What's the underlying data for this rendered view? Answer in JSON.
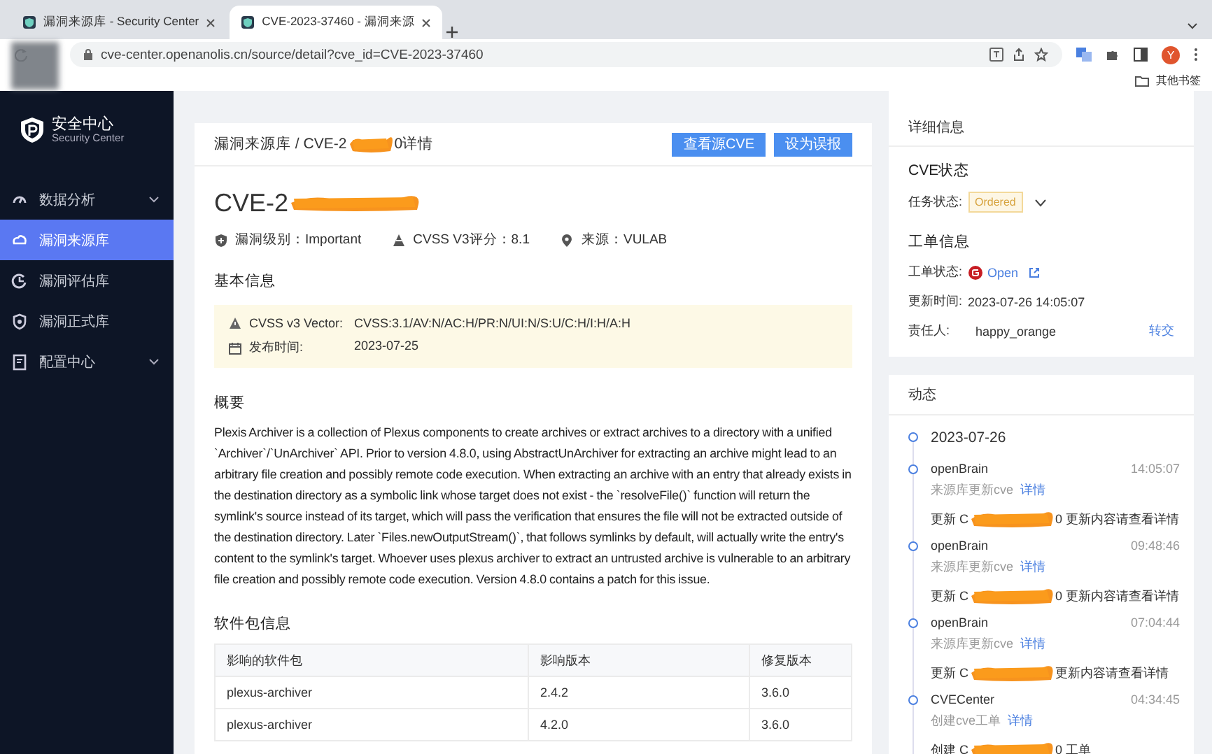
{
  "browser": {
    "tabs": [
      {
        "title": "漏洞来源库 - Security Center",
        "selected": false
      },
      {
        "title": "CVE-2023-37460 - 漏洞来源",
        "selected": true
      }
    ],
    "address": "cve-center.openanolis.cn/source/detail?cve_id=CVE-2023-37460",
    "avatar": "Y",
    "bookmarks": "其他书签"
  },
  "sidebar": {
    "logo_title": "安全中心",
    "logo_subtitle": "Security Center",
    "items": [
      {
        "label": "数据分析",
        "kind": "group",
        "selected": false
      },
      {
        "label": "漏洞来源库",
        "kind": "item",
        "selected": true
      },
      {
        "label": "漏洞评估库",
        "kind": "item",
        "selected": false
      },
      {
        "label": "漏洞正式库",
        "kind": "item",
        "selected": false
      },
      {
        "label": "配置中心",
        "kind": "group",
        "selected": false
      }
    ]
  },
  "main": {
    "breadcrumb": {
      "visible_start": "漏洞来源库 / CVE-2",
      "visible_end": "0详情"
    },
    "buttons": [
      "查看源CVE",
      "设为误报"
    ],
    "title_visible_start": "CVE-2",
    "meta": [
      {
        "kind": "level",
        "text": "漏洞级别：Important"
      },
      {
        "kind": "score",
        "text": "CVSS V3评分：8.1"
      },
      {
        "kind": "source",
        "text": "来源：VULAB"
      }
    ],
    "basic_info": {
      "heading": "基本信息",
      "rows": [
        {
          "kind": "vector",
          "label": "CVSS v3 Vector:",
          "value": "CVSS:3.1/AV:N/AC:H/PR:N/UI:N/S:U/C:H/I:H/A:H"
        },
        {
          "kind": "date",
          "label": "发布时间:",
          "value": "2023-07-25"
        }
      ]
    },
    "summary": {
      "heading": "概要",
      "text": "Plexis Archiver is a collection of Plexus components to create archives or extract archives to a directory with a unified `Archiver`/`UnArchiver` API. Prior to version 4.8.0, using AbstractUnArchiver for extracting an archive might lead to an arbitrary file creation and possibly remote code execution. When extracting an archive with an entry that already exists in the destination directory as a symbolic link whose target does not exist - the `resolveFile()` function will return the symlink's source instead of its target, which will pass the verification that ensures the file will not be extracted outside of the destination directory. Later `Files.newOutputStream()`, that follows symlinks by default, will actually write the entry's content to the symlink's target. Whoever uses plexus archiver to extract an untrusted archive is vulnerable to an arbitrary file creation and possibly remote code execution. Version 4.8.0 contains a patch for this issue."
    },
    "packages": {
      "heading": "软件包信息",
      "columns": [
        "影响的软件包",
        "影响版本",
        "修复版本"
      ],
      "rows": [
        [
          "plexus-archiver",
          "2.4.2",
          "3.6.0"
        ],
        [
          "plexus-archiver",
          "4.2.0",
          "3.6.0"
        ]
      ]
    }
  },
  "details": {
    "heading": "详细信息",
    "cve_status": {
      "heading": "CVE状态",
      "label": "任务状态:",
      "tag": "Ordered"
    },
    "ticket": {
      "heading": "工单信息",
      "status_label": "工单状态:",
      "status": "Open",
      "updated_label": "更新时间:",
      "updated": "2023-07-26 14:05:07",
      "owner_label": "责任人:",
      "owner": "happy_orange",
      "transfer": "转交"
    }
  },
  "activity": {
    "heading": "动态",
    "date": "2023-07-26",
    "events": [
      {
        "actor": "openBrain",
        "time": "14:05:07",
        "action": "来源库更新cve",
        "link": "详情",
        "message_start": "更新 C",
        "message_end": "0 更新内容请查看详情"
      },
      {
        "actor": "openBrain",
        "time": "09:48:46",
        "action": "来源库更新cve",
        "link": "详情",
        "message_start": "更新 C",
        "message_end": "0 更新内容请查看详情"
      },
      {
        "actor": "openBrain",
        "time": "07:04:44",
        "action": "来源库更新cve",
        "link": "详情",
        "message_start": "更新 C",
        "message_end": "更新内容请查看详情"
      },
      {
        "actor": "CVECenter",
        "time": "04:34:45",
        "action": "创建cve工单",
        "link": "详情",
        "message_start": "创建 C",
        "message_end": "0 工单"
      }
    ]
  }
}
